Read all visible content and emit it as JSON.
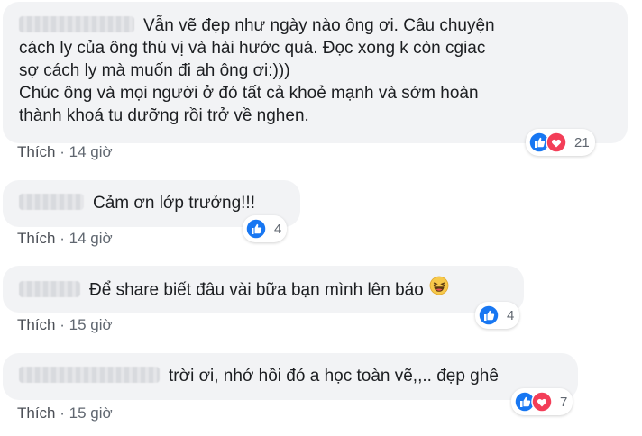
{
  "comments": [
    {
      "text_lines": [
        "Vẫn vẽ đẹp như ngày nào ông ơi. Câu chuyện",
        "cách ly của ông thú vị và hài hước quá. Đọc xong k còn cgiac",
        "sợ cách ly mà muốn đi ah ông ơi:)))",
        "Chúc ông và mọi người ở đó tất cả khoẻ mạnh và sớm hoàn",
        "thành khoá tu dưỡng rồi trở về nghen."
      ],
      "like_label": "Thích",
      "time": "14 giờ",
      "reaction_count": "21",
      "reactions": [
        "like-icon",
        "heart-icon"
      ]
    },
    {
      "text": "Cảm ơn lớp trưởng!!!",
      "like_label": "Thích",
      "time": "14 giờ",
      "reaction_count": "4",
      "reactions": [
        "like-icon"
      ]
    },
    {
      "text": "Để share biết đâu vài bữa bạn mình lên báo",
      "emoji": "laughing-emoji-icon",
      "like_label": "Thích",
      "time": "15 giờ",
      "reaction_count": "4",
      "reactions": [
        "like-icon"
      ]
    },
    {
      "text": "trời ơi, nhớ hồi đó a học toàn vẽ,,.. đẹp ghê",
      "like_label": "Thích",
      "time": "15 giờ",
      "reaction_count": "7",
      "reactions": [
        "like-icon",
        "heart-icon"
      ]
    }
  ],
  "colors": {
    "bubble": "#f2f3f5",
    "like_blue": "#1877f2",
    "heart_red": "#f33e58",
    "meta_gray": "#606770"
  }
}
